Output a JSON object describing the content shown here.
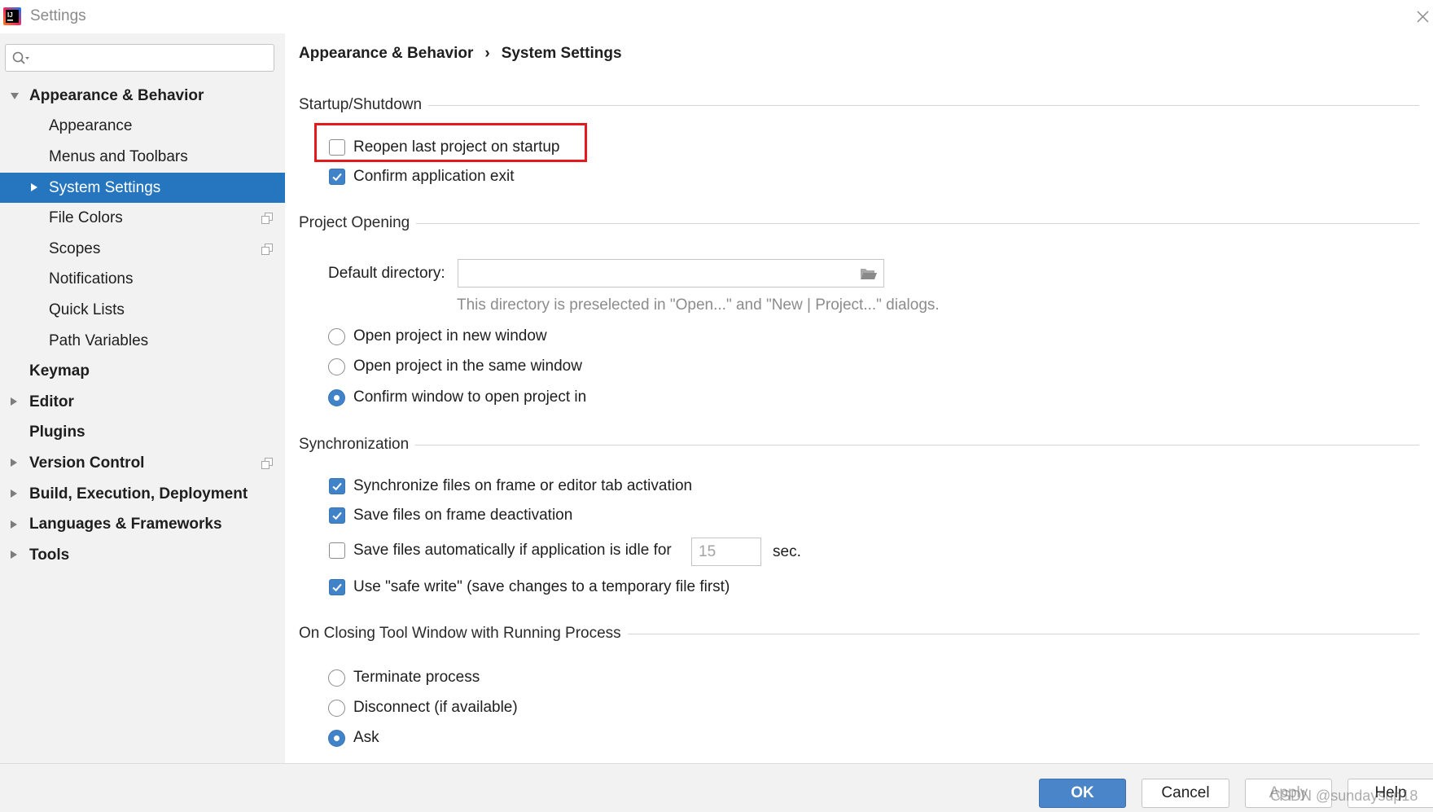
{
  "window": {
    "title": "Settings",
    "app_icon": {
      "name": "intellij-idea-icon",
      "lettering": "IJ"
    },
    "close_icon": "close-icon"
  },
  "search": {
    "placeholder": "",
    "value": "",
    "icon": "search-icon"
  },
  "sidebar": {
    "tree": [
      {
        "label": "Appearance & Behavior",
        "expanded": true,
        "children": [
          {
            "label": "Appearance"
          },
          {
            "label": "Menus and Toolbars"
          },
          {
            "label": "System Settings",
            "expanded": false,
            "selected": true
          },
          {
            "label": "File Colors",
            "icon": "project-level-icon"
          },
          {
            "label": "Scopes",
            "icon": "project-level-icon"
          },
          {
            "label": "Notifications"
          },
          {
            "label": "Quick Lists"
          },
          {
            "label": "Path Variables"
          }
        ]
      },
      {
        "label": "Keymap"
      },
      {
        "label": "Editor",
        "expanded": false
      },
      {
        "label": "Plugins"
      },
      {
        "label": "Version Control",
        "expanded": false,
        "icon": "project-level-icon"
      },
      {
        "label": "Build, Execution, Deployment",
        "expanded": false
      },
      {
        "label": "Languages & Frameworks",
        "expanded": false
      },
      {
        "label": "Tools",
        "expanded": false
      }
    ]
  },
  "breadcrumb": {
    "parent": "Appearance & Behavior",
    "separator": "›",
    "current": "System Settings"
  },
  "startup": {
    "title": "Startup/Shutdown",
    "reopen_last_project": {
      "label": "Reopen last project on startup",
      "checked": false,
      "highlighted": true
    },
    "confirm_exit": {
      "label": "Confirm application exit",
      "checked": true
    }
  },
  "project_opening": {
    "title": "Project Opening",
    "default_directory": {
      "label": "Default directory:",
      "value": "",
      "browse_icon": "folder-icon"
    },
    "hint": "This directory is preselected in \"Open...\" and \"New | Project...\" dialogs.",
    "options": [
      {
        "label": "Open project in new window",
        "selected": false
      },
      {
        "label": "Open project in the same window",
        "selected": false
      },
      {
        "label": "Confirm window to open project in",
        "selected": true
      }
    ]
  },
  "synchronization": {
    "title": "Synchronization",
    "sync_on_activation": {
      "label": "Synchronize files on frame or editor tab activation",
      "checked": true
    },
    "save_on_deactivation": {
      "label": "Save files on frame deactivation",
      "checked": true
    },
    "autosave_idle": {
      "label": "Save files automatically if application is idle for",
      "checked": false,
      "seconds": "15",
      "seconds_disabled": true,
      "unit": "sec."
    },
    "safe_write": {
      "label": "Use \"safe write\" (save changes to a temporary file first)",
      "checked": true
    }
  },
  "closing_tool_window": {
    "title": "On Closing Tool Window with Running Process",
    "options": [
      {
        "label": "Terminate process",
        "selected": false
      },
      {
        "label": "Disconnect (if available)",
        "selected": false
      },
      {
        "label": "Ask",
        "selected": true
      }
    ]
  },
  "buttons": {
    "ok": "OK",
    "cancel": "Cancel",
    "apply": "Apply",
    "apply_disabled": true,
    "help": "Help"
  },
  "watermark": "CSDN @sundaysup18",
  "colors": {
    "sidebar_background": "#f2f2f2",
    "selection": "#2675bf",
    "accent": "#4083c9",
    "primary_button": "#4a84c9",
    "highlight_box": "#e3191b",
    "hint_text": "#8c8c8c"
  }
}
